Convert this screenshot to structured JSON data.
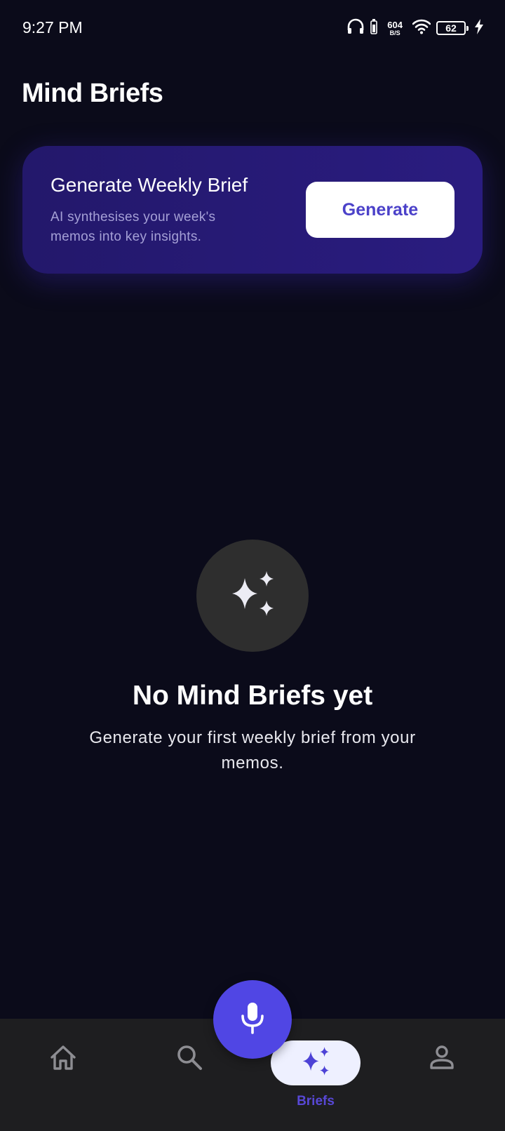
{
  "status_bar": {
    "time": "9:27 PM",
    "net_speed_value": "604",
    "net_speed_unit": "B/S",
    "battery_level": "62",
    "icons": [
      "headphones-icon",
      "battery-small-icon",
      "wifi-icon",
      "battery-icon",
      "charging-bolt-icon"
    ]
  },
  "header": {
    "title": "Mind Briefs"
  },
  "brief_card": {
    "title": "Generate Weekly Brief",
    "description": "AI synthesises your week's memos into key insights.",
    "button_label": "Generate"
  },
  "empty_state": {
    "icon": "sparkles-icon",
    "title": "No Mind Briefs yet",
    "description": "Generate your first weekly brief from your memos."
  },
  "bottom_nav": {
    "items": [
      {
        "icon": "home-icon",
        "label": "",
        "active": false
      },
      {
        "icon": "search-icon",
        "label": "",
        "active": false
      },
      {
        "icon": "sparkles-icon",
        "label": "Briefs",
        "active": true
      },
      {
        "icon": "profile-icon",
        "label": "",
        "active": false
      }
    ],
    "fab_icon": "microphone-icon"
  },
  "colors": {
    "background": "#0b0b1a",
    "card": "#271a78",
    "accent": "#5046e4",
    "button_text": "#4b41c9",
    "nav_background": "#1e1e20"
  }
}
